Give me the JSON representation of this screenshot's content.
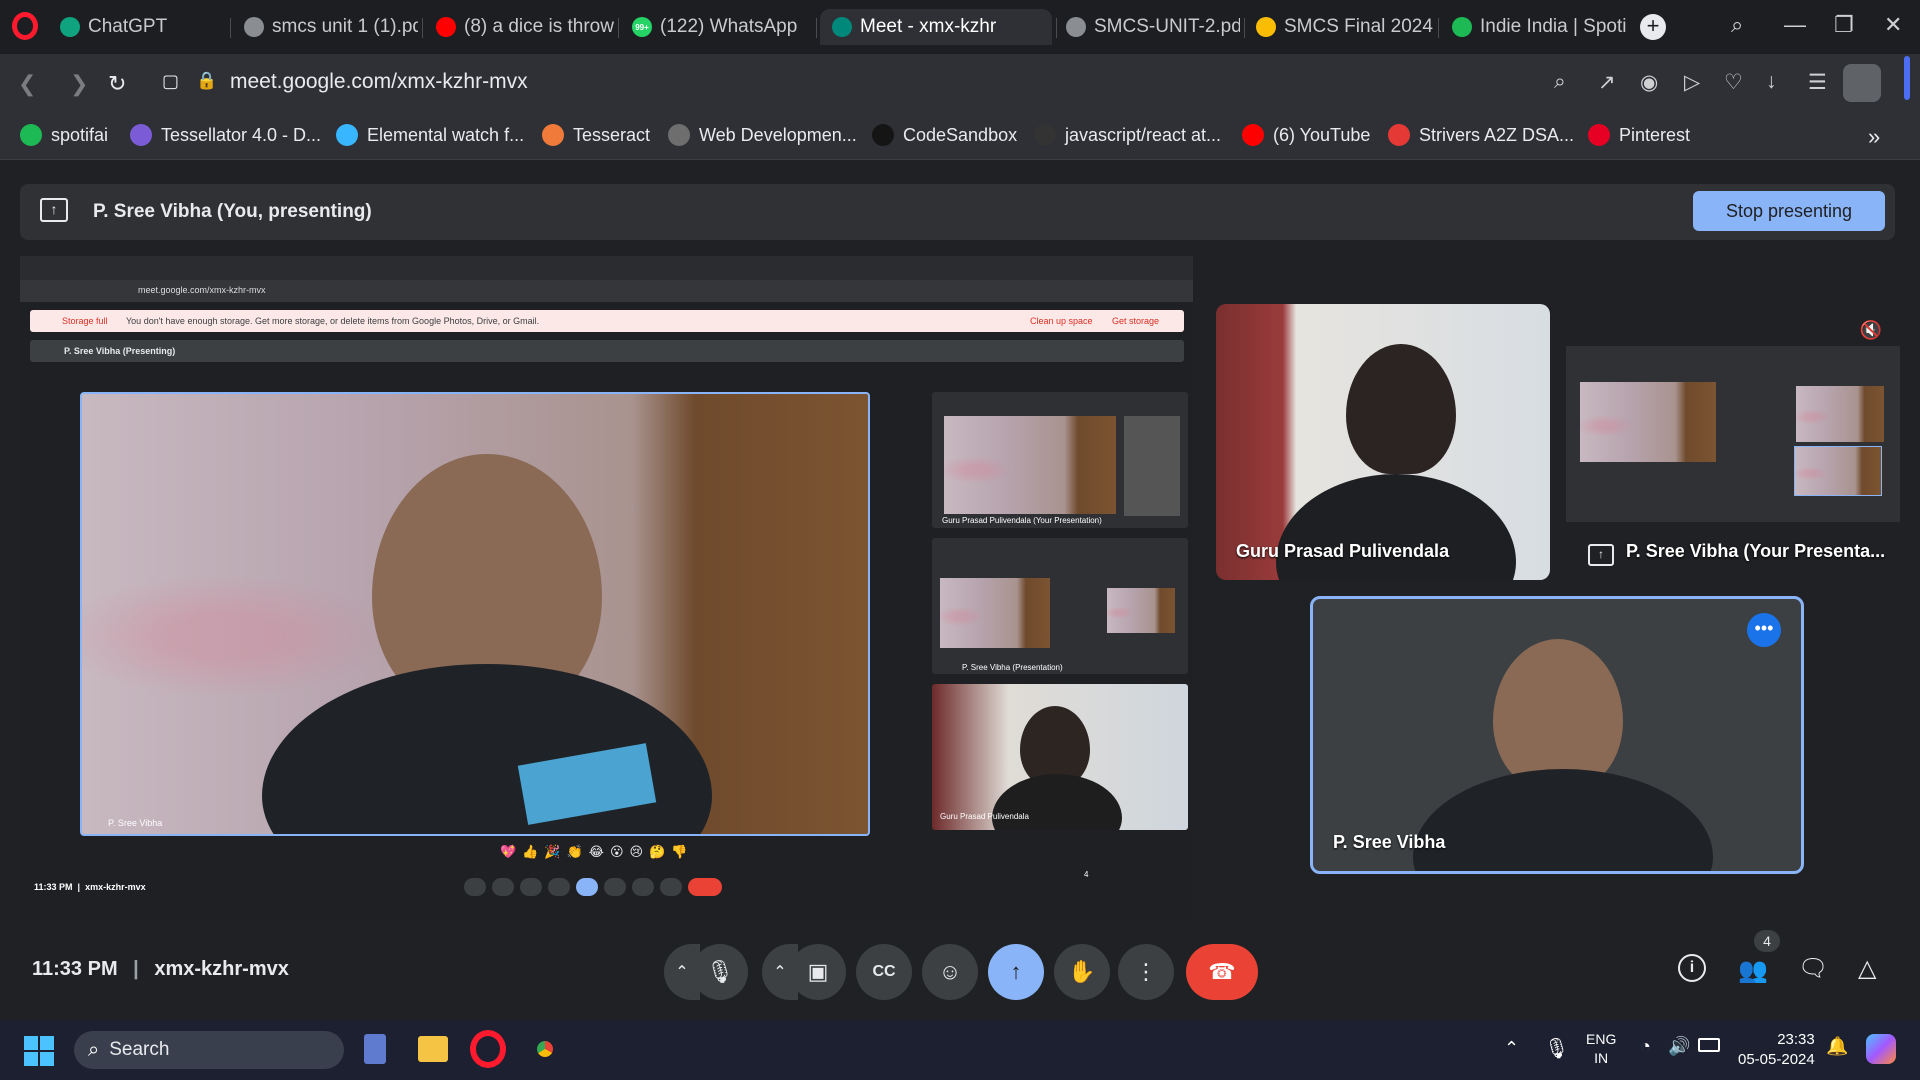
{
  "tabs": [
    {
      "title": "ChatGPT",
      "icon": "chatgpt-icon"
    },
    {
      "title": "smcs unit 1 (1).pdf",
      "icon": "globe-icon"
    },
    {
      "title": "(8) a dice is throw",
      "icon": "youtube-icon"
    },
    {
      "title": "(122) WhatsApp",
      "icon": "whatsapp-icon",
      "badge": "99+"
    },
    {
      "title": "Meet - xmx-kzhr",
      "icon": "meet-icon",
      "active": true
    },
    {
      "title": "SMCS-UNIT-2.pdf",
      "icon": "globe-icon"
    },
    {
      "title": "SMCS Final 2024",
      "icon": "drive-icon"
    },
    {
      "title": "Indie India | Spoti",
      "icon": "spotify-icon"
    }
  ],
  "address": {
    "url": "meet.google.com/xmx-kzhr-mvx"
  },
  "bookmarks": [
    {
      "label": "spotifai",
      "color": "#1db954"
    },
    {
      "label": "Tessellator 4.0 - D...",
      "color": "#7b5cd6"
    },
    {
      "label": "Elemental watch f...",
      "color": "#38b6ff"
    },
    {
      "label": "Tesseract",
      "color": "#f07a3a"
    },
    {
      "label": "Web Developmen...",
      "color": "#6e6e6e"
    },
    {
      "label": "CodeSandbox",
      "color": "#151515"
    },
    {
      "label": "javascript/react at...",
      "color": "#333"
    },
    {
      "label": "(6) YouTube",
      "color": "#ff0000"
    },
    {
      "label": "Strivers A2Z DSA...",
      "color": "#e53935"
    },
    {
      "label": "Pinterest",
      "color": "#e60023"
    }
  ],
  "present_bar": {
    "label": "P. Sree Vibha (You, presenting)",
    "stop_label": "Stop presenting"
  },
  "shared_screen": {
    "url": "meet.google.com/xmx-kzhr-mvx",
    "storage_title": "Storage full",
    "storage_text": "You don't have enough storage. Get more storage, or delete items from Google Photos, Drive, or Gmail.",
    "clean_label": "Clean up space",
    "get_label": "Get storage",
    "presenting_label": "P. Sree Vibha (Presenting)",
    "main_name": "P. Sree Vibha",
    "thumb1_name": "Guru Prasad Pulivendala (Your Presentation)",
    "thumb2_name": "P. Sree Vibha (Presentation)",
    "thumb3_name": "Guru Prasad Pulivendala",
    "time": "11:33 PM",
    "code": "xmx-kzhr-mvx",
    "participants_count": "4",
    "reactions": [
      "💖",
      "👍",
      "🎉",
      "👏",
      "😂",
      "😮",
      "😢",
      "🤔",
      "👎"
    ]
  },
  "tiles": {
    "guru": "Guru Prasad Pulivendala",
    "presentation": "P. Sree Vibha (Your Presenta...",
    "self": "P. Sree Vibha"
  },
  "bottom": {
    "time": "11:33 PM",
    "code": "xmx-kzhr-mvx",
    "participants_count": "4"
  },
  "taskbar": {
    "search": "Search",
    "lang1": "ENG",
    "lang2": "IN",
    "time": "23:33",
    "date": "05-05-2024"
  }
}
